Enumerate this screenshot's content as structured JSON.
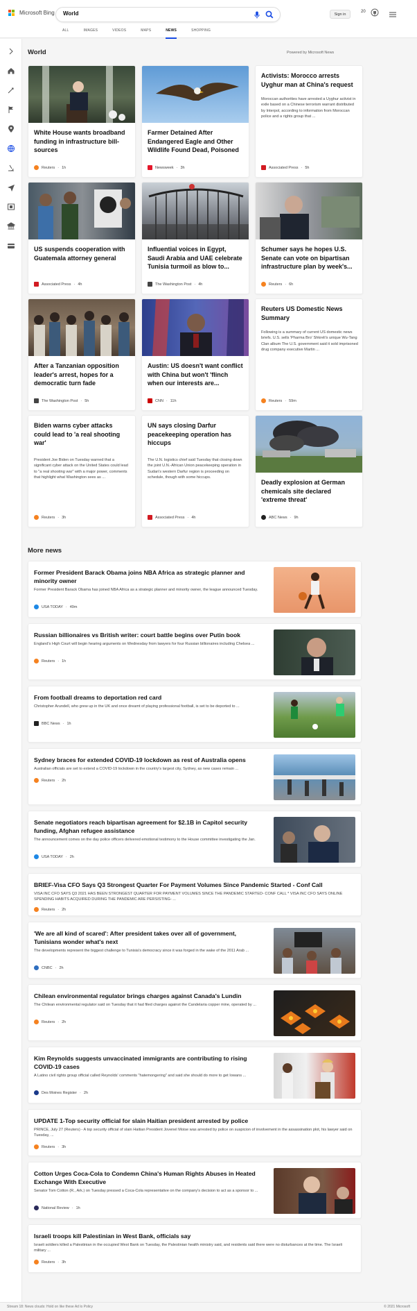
{
  "header": {
    "brand": "Microsoft Bing",
    "search_value": "World",
    "sign_in": "Sign in",
    "rewards_points": "20"
  },
  "tabs": [
    {
      "label": "ALL",
      "active": false
    },
    {
      "label": "IMAGES",
      "active": false
    },
    {
      "label": "VIDEOS",
      "active": false
    },
    {
      "label": "MAPS",
      "active": false
    },
    {
      "label": "NEWS",
      "active": true
    },
    {
      "label": "SHOPPING",
      "active": false
    }
  ],
  "rail_icons": [
    "expand-icon",
    "home-icon",
    "rocket-icon",
    "flag-icon",
    "location-icon",
    "globe-icon",
    "microscope-icon",
    "plane-icon",
    "film-icon",
    "bank-icon",
    "card-icon"
  ],
  "section": {
    "title": "World",
    "powered_by": "Powered by Microsoft News"
  },
  "cards": [
    {
      "title": "White House wants broadband funding in infrastructure bill-sources",
      "source": "Reuters",
      "time": "1h",
      "image": "president-podium-photo"
    },
    {
      "title": "Farmer Detained After Endangered Eagle and Other Wildlife Found Dead, Poisoned",
      "source": "Newsweek",
      "time": "3h",
      "image": "eagle-photo"
    },
    {
      "title": "Activists: Morocco arrests Uyghur man at China's request",
      "snippet": "Moroccan authorities have arrested a Uyghur activist in exile based on a Chinese terrorism warrant distributed by Interpol, according to information from Moroccan police and a rights group that ...",
      "source": "Associated Press",
      "time": "5h"
    },
    {
      "title": "US suspends cooperation with Guatemala attorney general",
      "source": "Associated Press",
      "time": "4h",
      "image": "protest-portrait-photo"
    },
    {
      "title": "Influential voices in Egypt, Saudi Arabia and UAE celebrate Tunisia turmoil as blow to...",
      "source": "The Washington Post",
      "time": "4h",
      "image": "gate-crowd-photo"
    },
    {
      "title": "Schumer says he hopes U.S. Senate can vote on bipartisan infrastructure plan by week's...",
      "source": "Reuters",
      "time": "6h",
      "image": "schumer-photo"
    },
    {
      "title": "After a Tanzanian opposition leader's arrest, hopes for a democratic turn fade",
      "source": "The Washington Post",
      "time": "5h",
      "image": "crowd-photo"
    },
    {
      "title": "Austin: US doesn't want conflict with China but won't 'flinch when our interests are...",
      "source": "CNN",
      "time": "11h",
      "image": "austin-flags-photo"
    },
    {
      "title": "Reuters US Domestic News Summary",
      "snippet": "Following is a summary of current US domestic news briefs. U.S. sells 'Pharma Bro' Shkreli's unique Wu-Tang Clan album The U.S. government said it sold imprisoned drug company executive Martin ...",
      "source": "Reuters",
      "time": "59m"
    },
    {
      "title": "Biden warns cyber attacks could lead to 'a real shooting war'",
      "snippet": "President Joe Biden on Tuesday warned that a significant cyber attack on the United States could lead to \"a real shooting war\" with a major power, comments that highlight what Washington sees as ...",
      "source": "Reuters",
      "time": "3h"
    },
    {
      "title": "UN says closing Darfur peacekeeping operation has hiccups",
      "snippet": "The U.N. logistics chief said Tuesday that closing down the joint U.N.-African Union peacekeeping operation in Sudan's western Darfur region is proceeding on schedule, though with some hiccups.",
      "source": "Associated Press",
      "time": "4h"
    },
    {
      "title": "Deadly explosion at German chemicals site declared 'extreme threat'",
      "source": "ABC News",
      "time": "9h",
      "image": "explosion-smoke-photo"
    }
  ],
  "more_news": {
    "title": "More news",
    "items": [
      {
        "title": "Former President Barack Obama joins NBA Africa as strategic planner and minority owner",
        "snippet": "Former President Barack Obama has joined NBA Africa as a strategic planner and minority owner, the league announced Tuesday.",
        "source": "USA TODAY",
        "time": "49m",
        "image": "basketball-player-photo"
      },
      {
        "title": "Russian billionaires vs British writer: court battle begins over Putin book",
        "snippet": "England's High Court will begin hearing arguments on Wednesday from lawyers for four Russian billionaires including Chelsea ...",
        "source": "Reuters",
        "time": "1h",
        "image": "billionaire-portrait-photo"
      },
      {
        "title": "From football dreams to deportation red card",
        "snippet": "Christopher Arundell, who grew up in the UK and once dreamt of playing professional football, is set to be deported to ...",
        "source": "BBC News",
        "time": "1h",
        "image": "football-match-photo"
      },
      {
        "title": "Sydney braces for extended COVID-19 lockdown as rest of Australia opens",
        "snippet": "Australian officials are set to extend a COVID-19 lockdown in the country's largest city, Sydney, as new cases remain ...",
        "source": "Reuters",
        "time": "2h",
        "image": "sydney-waterfront-photo"
      },
      {
        "title": "Senate negotiators reach bipartisan agreement for $2.1B in Capitol security funding, Afghan refugee assistance",
        "snippet": "The announcement comes on the day police officers delivered emotional testimony to the House committee investigating the Jan.",
        "source": "USA TODAY",
        "time": "2h",
        "image": "senator-photo"
      },
      {
        "title": "BRIEF-Visa CFO Says Q3 Strongest Quarter For Payment Volumes Since Pandemic Started - Conf Call",
        "snippet": "VISA INC CFO SAYS Q3 2021 HAS BEEN STRONGEST QUARTER FOR PAYMENT VOLUMES SINCE THE PANDEMIC STARTED- CONF CALL * VISA INC CFO SAYS ONLINE SPENDING HABITS ACQUIRED DURING THE PANDEMIC ARE PERSISTING- ...",
        "source": "Reuters",
        "time": "2h"
      },
      {
        "title": "'We are all kind of scared': After president takes over all of government, Tunisians wonder what's next",
        "snippet": "The developments represent the biggest challenge to Tunisia's democracy since it was forged in the wake of the 2011 Arab ...",
        "source": "CNBC",
        "time": "2h",
        "image": "tunisia-protest-photo"
      },
      {
        "title": "Chilean environmental regulator brings charges against Canada's Lundin",
        "snippet": "The Chilean environmental regulator said on Tuesday that it had filed charges against the Candelaria copper mine, operated by ...",
        "source": "Reuters",
        "time": "2h",
        "image": "copper-mine-photo"
      },
      {
        "title": "Kim Reynolds suggests unvaccinated immigrants are contributing to rising COVID-19 cases",
        "snippet": "A Latino civil rights group official called Reynolds' comments \"hatemongering\" and said she should do more to get Iowans ...",
        "source": "Des Moines Register",
        "time": "2h",
        "image": "reynolds-podium-photo"
      },
      {
        "title": "UPDATE 1-Top security official for slain Haitian president arrested by police",
        "snippet": "PRINCE, July 27 (Reuters) - A top security official of slain Haitian President Jovenel Moise was arrested by police on suspicion of involvement in the assassination plot, his lawyer said on Tuesday, ...",
        "source": "Reuters",
        "time": "3h"
      },
      {
        "title": "Cotton Urges Coca-Cola to Condemn China's Human Rights Abuses in Heated Exchange With Executive",
        "snippet": "Senator Tom Cotton (R., Ark.) on Tuesday pressed a Coca-Cola representative on the company's decision to act as a sponsor to ...",
        "source": "National Review",
        "time": "1h",
        "image": "cotton-hearing-photo"
      },
      {
        "title": "Israeli troops kill Palestinian in West Bank, officials say",
        "snippet": "Israeli soldiers killed a Palestinian in the occupied West Bank on Tuesday, the Palestinian health ministry said, and residents said there were no disturbances at the time. The Israeli military ...",
        "source": "Reuters",
        "time": "3h"
      }
    ]
  },
  "footer": {
    "left": "Stream 18: News clouds: Hold on like these Ad lo Policy",
    "right": "© 2021 Microsoft"
  },
  "colors": {
    "accent": "#174ae4",
    "reuters": "#f58220",
    "ap": "#d21b22",
    "newsweek": "#e4172b",
    "cnn": "#cc0000",
    "usatoday": "#1e88e5",
    "bbc": "#222222",
    "cnbc": "#2f6ebf",
    "wapo": "#444444"
  }
}
